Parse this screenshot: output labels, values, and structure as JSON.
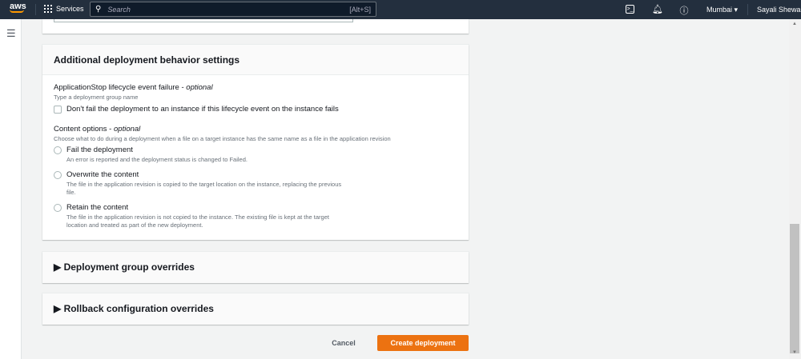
{
  "nav": {
    "logo": "aws",
    "services": "Services",
    "search_placeholder": "Search",
    "search_shortcut": "[Alt+S]",
    "region": "Mumbai ▾",
    "user": "Sayali Shewale"
  },
  "sections": {
    "additional": {
      "title": "Additional deployment behavior settings",
      "appstop_label": "ApplicationStop lifecycle event failure - ",
      "appstop_optional": "optional",
      "appstop_desc": "Type a deployment group name",
      "appstop_checkbox": "Don't fail the deployment to an instance if this lifecycle event on the instance fails",
      "content_label": "Content options - ",
      "content_optional": "optional",
      "content_desc": "Choose what to do during a deployment when a file on a target instance has the same name as a file in the application revision",
      "options": [
        {
          "label": "Fail the deployment",
          "desc": "An error is reported and the deployment status is changed to Failed."
        },
        {
          "label": "Overwrite the content",
          "desc": "The file in the application revision is copied to the target location on the instance, replacing the previous file."
        },
        {
          "label": "Retain the content",
          "desc": "The file in the application revision is not copied to the instance. The existing file is kept at the target location and treated as part of the new deployment."
        }
      ]
    },
    "group_overrides": "▶ Deployment group overrides",
    "rollback_overrides": "▶ Rollback configuration overrides"
  },
  "actions": {
    "cancel": "Cancel",
    "create": "Create deployment"
  }
}
